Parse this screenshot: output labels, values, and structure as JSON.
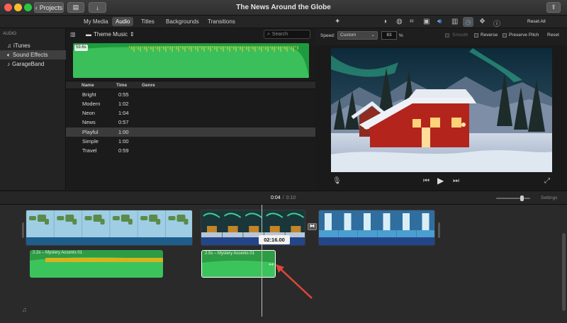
{
  "window": {
    "title": "The News Around the Globe"
  },
  "toolbar": {
    "projects_label": "Projects"
  },
  "tabs": [
    {
      "label": "My Media",
      "active": false
    },
    {
      "label": "Audio",
      "active": true
    },
    {
      "label": "Titles",
      "active": false
    },
    {
      "label": "Backgrounds",
      "active": false
    },
    {
      "label": "Transitions",
      "active": false
    }
  ],
  "sidebar": {
    "heading": "AUDIO",
    "items": [
      {
        "label": "iTunes",
        "icon": "music-note-icon",
        "selected": false
      },
      {
        "label": "Sound Effects",
        "icon": "speaker-icon",
        "selected": true
      },
      {
        "label": "GarageBand",
        "icon": "guitar-icon",
        "selected": false
      }
    ]
  },
  "browser": {
    "source_label": "Theme Music",
    "search_placeholder": "Search",
    "preview_duration": "59.6s",
    "columns": {
      "name": "Name",
      "time": "Time",
      "genre": "Genre"
    },
    "rows": [
      {
        "name": "Bright",
        "time": "0:55",
        "selected": false
      },
      {
        "name": "Modern",
        "time": "1:02",
        "selected": false
      },
      {
        "name": "Neon",
        "time": "1:04",
        "selected": false
      },
      {
        "name": "News",
        "time": "0:57",
        "selected": false
      },
      {
        "name": "Playful",
        "time": "1:00",
        "selected": true
      },
      {
        "name": "Simple",
        "time": "1:00",
        "selected": false
      },
      {
        "name": "Travel",
        "time": "0:59",
        "selected": false
      }
    ]
  },
  "viewer": {
    "reset_all_label": "Reset All",
    "speed_label": "Speed:",
    "speed_value": "Custom",
    "speed_percent": "83",
    "percent_sign": "%",
    "smooth_label": "Smooth",
    "reverse_label": "Reverse",
    "preserve_pitch_label": "Preserve Pitch",
    "reset_label": "Reset"
  },
  "timeline": {
    "current_time": "0:04",
    "separator": "/",
    "total_time": "0:10",
    "settings_label": "Settings",
    "zoom_level": 0.75,
    "skimmer_time": "02:16.00",
    "audio_clips": [
      {
        "label": "2.2s – Mystery Accents 01"
      },
      {
        "label": "2.5s – Mystery Accents 01"
      }
    ],
    "transition_icon": "transition-icon"
  },
  "colors": {
    "accent": "#3b8ee6",
    "audio_green": "#2e9c45",
    "annotation_arrow": "#e0463a"
  }
}
